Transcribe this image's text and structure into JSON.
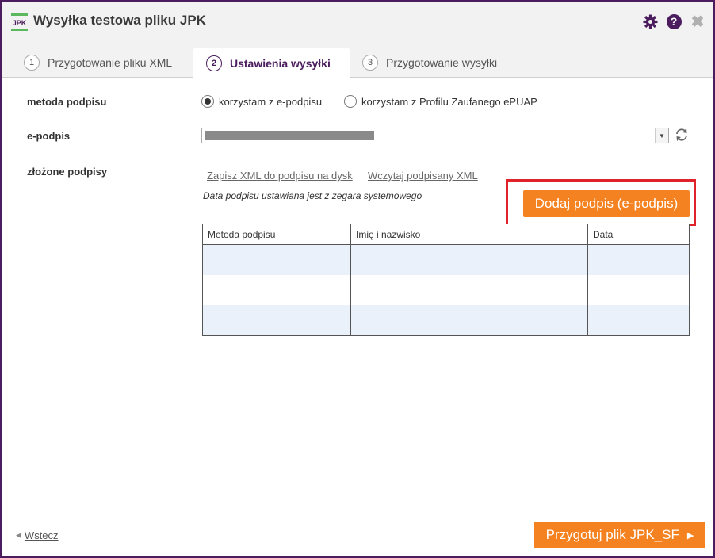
{
  "window": {
    "title": "Wysyłka testowa pliku JPK",
    "logo_text": "JPK",
    "icons": [
      "gear-icon",
      "help-icon",
      "close-icon"
    ],
    "help_glyph": "?",
    "close_glyph": "✖"
  },
  "tabs": [
    {
      "num": "1",
      "label": "Przygotowanie pliku XML",
      "active": false
    },
    {
      "num": "2",
      "label": "Ustawienia wysyłki",
      "active": true
    },
    {
      "num": "3",
      "label": "Przygotowanie wysyłki",
      "active": false
    }
  ],
  "form": {
    "signature_method": {
      "label": "metoda podpisu",
      "options": [
        {
          "label": "korzystam z e-podpisu",
          "checked": true
        },
        {
          "label": "korzystam z Profilu Zaufanego ePUAP",
          "checked": false
        }
      ]
    },
    "epodpis": {
      "label": "e-podpis",
      "value_redacted": true
    },
    "signatures": {
      "label": "złożone podpisy",
      "save_link": "Zapisz XML do podpisu na dysk",
      "load_link": "Wczytaj podpisany XML",
      "note": "Data podpisu ustawiana jest z zegara systemowego",
      "add_button": "Dodaj podpis (e-podpis)",
      "table": {
        "columns": [
          "Metoda podpisu",
          "Imię i nazwisko",
          "Data"
        ],
        "rows": [
          [
            "",
            "",
            ""
          ],
          [
            "",
            "",
            ""
          ],
          [
            "",
            "",
            ""
          ]
        ]
      }
    }
  },
  "footer": {
    "back_label": "Wstecz",
    "next_label": "Przygotuj plik JPK_SF"
  },
  "colors": {
    "accent_purple": "#4b1d5e",
    "button_orange": "#f58220",
    "highlight_red": "#e0232a",
    "logo_green": "#5cb85c"
  }
}
